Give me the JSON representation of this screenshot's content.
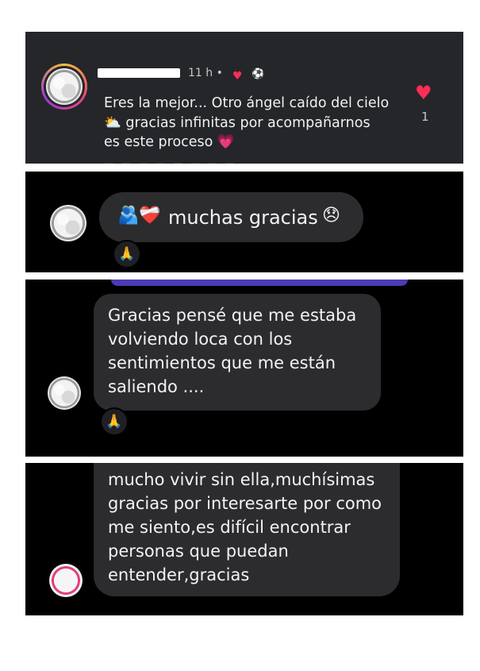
{
  "comment1": {
    "time": "11 h",
    "dot": "•",
    "reaction_heart": "♥",
    "reaction_emoji": "⚽",
    "text": "Eres la mejor... Otro ángel caído del cielo ⛅ gracias infinitas por acompañarnos es este proceso 💗",
    "like_icon": "♥",
    "like_count": "1"
  },
  "comment2": {
    "emoji_left": "🫂❤️‍🩹",
    "text": "muchas gracias",
    "emoji_right": "😞",
    "reaction": "🙏"
  },
  "comment3": {
    "text": "Gracias pensé que me estaba volviendo loca con los sentimientos que me están saliendo ....",
    "reaction": "🙏"
  },
  "comment4": {
    "text": "mucho vivir sin ella,muchísimas gracias por interesarte por como me siento,es difícil encontrar personas que puedan entender,gracias"
  },
  "colors": {
    "accent_heart": "#ff2d55",
    "bubble": "#2c2c2f",
    "panel_dark": "#25262a",
    "purple_strip": "#4a3bb5"
  }
}
